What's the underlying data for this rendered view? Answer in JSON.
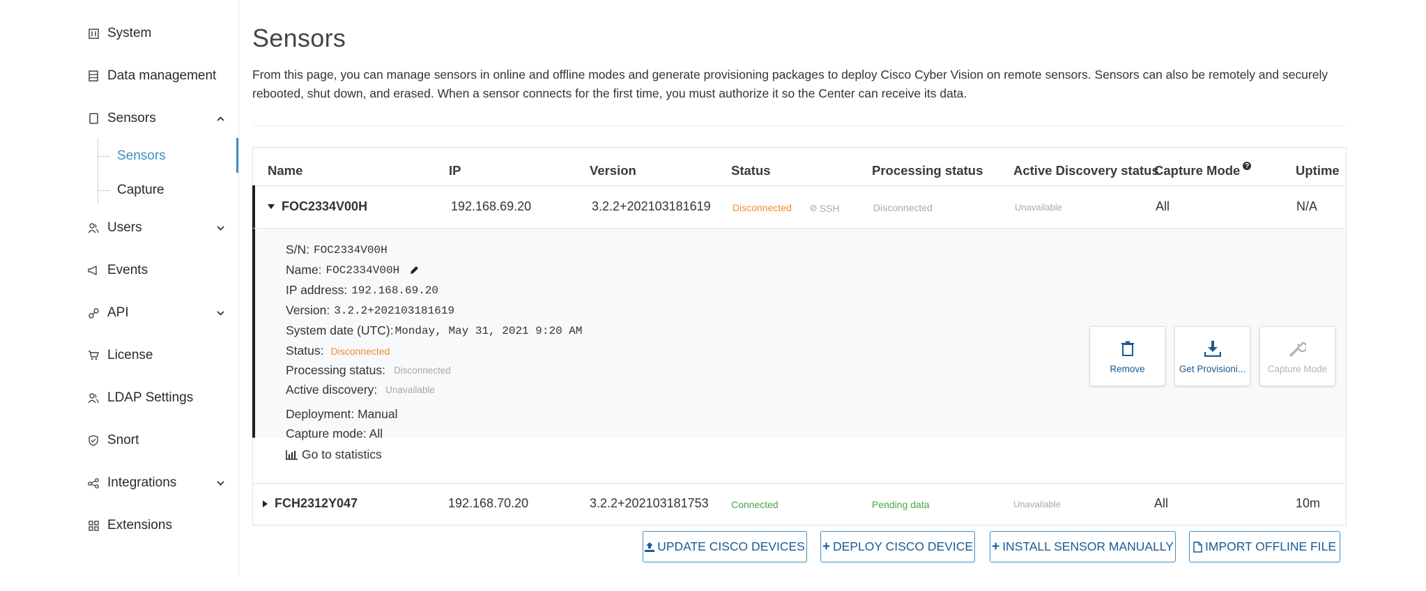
{
  "sidebar": {
    "items": [
      {
        "label": "System",
        "icon": "system-icon"
      },
      {
        "label": "Data management",
        "icon": "data-management-icon"
      },
      {
        "label": "Sensors",
        "icon": "sensors-icon"
      },
      {
        "label": "Users",
        "icon": "users-icon"
      },
      {
        "label": "Events",
        "icon": "events-icon"
      },
      {
        "label": "API",
        "icon": "api-icon"
      },
      {
        "label": "License",
        "icon": "license-icon"
      },
      {
        "label": "LDAP Settings",
        "icon": "ldap-icon"
      },
      {
        "label": "Snort",
        "icon": "snort-icon"
      },
      {
        "label": "Integrations",
        "icon": "integrations-icon"
      },
      {
        "label": "Extensions",
        "icon": "extensions-icon"
      }
    ],
    "sensors_sub": [
      "Sensors",
      "Capture"
    ],
    "active_sub": "Sensors"
  },
  "page": {
    "title": "Sensors",
    "description": "From this page, you can manage sensors in online and offline modes and generate provisioning packages to deploy Cisco Cyber Vision on remote sensors. Sensors can also be remotely and securely rebooted, shut down, and erased. When a sensor connects for the first time, you must authorize it so the Center can receive its data."
  },
  "table": {
    "columns": [
      "Name",
      "IP",
      "Version",
      "Status",
      "Processing status",
      "Active Discovery status",
      "Capture Mode",
      "Uptime"
    ],
    "rows": [
      {
        "name": "FOC2334V00H",
        "ip": "192.168.69.20",
        "version": "3.2.2+202103181619",
        "status": "Disconnected",
        "ssh": "SSH",
        "processing": "Disconnected",
        "active_discovery": "Unavailable",
        "capture_mode": "All",
        "uptime": "N/A"
      },
      {
        "name": "FCH2312Y047",
        "ip": "192.168.70.20",
        "version": "3.2.2+202103181753",
        "status": "Connected",
        "processing": "Pending data",
        "active_discovery": "Unavailable",
        "capture_mode": "All",
        "uptime": "10m"
      }
    ]
  },
  "detail": {
    "sn_label": "S/N:",
    "sn": "FOC2334V00H",
    "name_label": "Name:",
    "name": "FOC2334V00H",
    "ip_label": "IP address:",
    "ip": "192.168.69.20",
    "version_label": "Version:",
    "version": "3.2.2+202103181619",
    "date_label": "System date (UTC):",
    "date": "Monday, May 31, 2021 9:20 AM",
    "status_label": "Status:",
    "status": "Disconnected",
    "processing_label": "Processing status:",
    "processing": "Disconnected",
    "discovery_label": "Active discovery:",
    "discovery": "Unavailable",
    "deployment": "Deployment: Manual",
    "capture": "Capture mode: All",
    "stats_link": "Go to statistics",
    "actions": [
      "Remove",
      "Get Provisioni...",
      "Capture Mode"
    ]
  },
  "buttons": {
    "update": "UPDATE CISCO DEVICES",
    "deploy": "DEPLOY CISCO DEVICE",
    "install": "INSTALL SENSOR MANUALLY",
    "import": "IMPORT OFFLINE FILE"
  },
  "colors": {
    "accent": "#3a8fc7",
    "warning": "#f08a24",
    "success": "#46a546",
    "muted": "#a8a8a8"
  }
}
